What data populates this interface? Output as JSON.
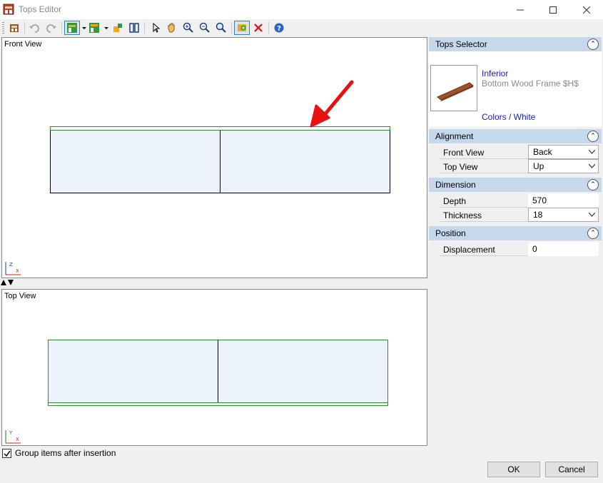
{
  "window": {
    "title": "Tops Editor"
  },
  "toolbar": {
    "icons": [
      "insert-icon",
      "undo-icon",
      "redo-icon",
      "front-view-layout-icon",
      "top-view-layout-icon",
      "color-icon",
      "mirror-icon",
      "pointer-icon",
      "pan-icon",
      "zoom-window-icon",
      "zoom-out-icon",
      "zoom-extents-icon",
      "add-top-icon",
      "delete-icon",
      "help-icon"
    ]
  },
  "views": {
    "front": {
      "label": "Front View",
      "axes": [
        "Z",
        "X"
      ]
    },
    "top": {
      "label": "Top View",
      "axes": [
        "Y",
        "X"
      ]
    }
  },
  "panel": {
    "selector": {
      "header": "Tops Selector",
      "name": "Inferior",
      "description": "Bottom Wood Frame $H$",
      "color": "Colors / White"
    },
    "alignment": {
      "header": "Alignment",
      "rows": [
        {
          "label": "Front View",
          "value": "Back"
        },
        {
          "label": "Top View",
          "value": "Up"
        }
      ]
    },
    "dimension": {
      "header": "Dimension",
      "rows": [
        {
          "label": "Depth",
          "value": "570"
        },
        {
          "label": "Thickness",
          "value": "18"
        }
      ]
    },
    "position": {
      "header": "Position",
      "rows": [
        {
          "label": "Displacement",
          "value": "0"
        }
      ]
    }
  },
  "footer": {
    "group_label": "Group items after insertion",
    "group_checked": true,
    "ok_label": "OK",
    "cancel_label": "Cancel"
  }
}
